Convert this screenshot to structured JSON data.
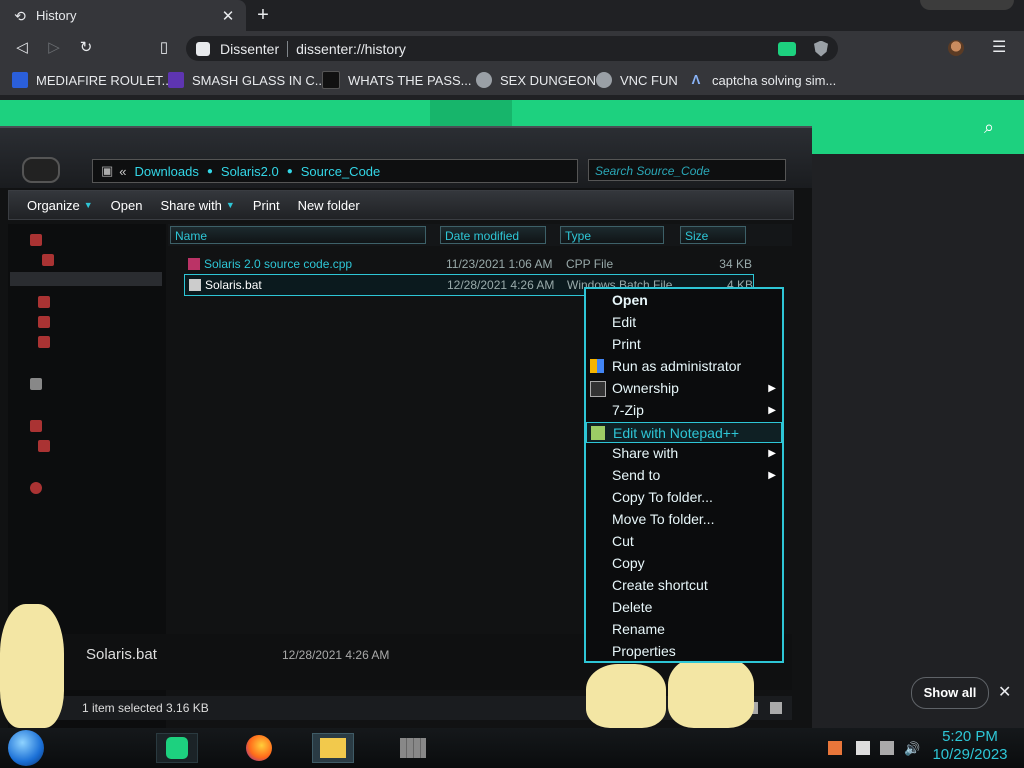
{
  "browser": {
    "tab_title": "History",
    "tab_close": "✕",
    "new_tab": "+",
    "site_name": "Dissenter",
    "url": "dissenter://history",
    "bookmarks": [
      {
        "label": "MEDIAFIRE ROULET...",
        "color": "#2b5fd9"
      },
      {
        "label": "SMASH GLASS IN C...",
        "color": "#5e35b1"
      },
      {
        "label": "WHATS THE PASS...",
        "color": "#222222"
      },
      {
        "label": "SEX DUNGEON",
        "color": "#9aa0a6"
      },
      {
        "label": "VNC FUN",
        "color": "#9aa0a6"
      },
      {
        "label": "captcha solving sim...",
        "color": "#8ab4f8"
      }
    ]
  },
  "explorer": {
    "breadcrumb": [
      "Downloads",
      "Solaris2.0",
      "Source_Code"
    ],
    "breadcrumb_prefix": "«",
    "search_placeholder": "Search Source_Code",
    "commands": [
      "Organize",
      "Open",
      "Share with",
      "Print",
      "New folder"
    ],
    "columns": [
      "Name",
      "Date modified",
      "Type",
      "Size"
    ],
    "files": [
      {
        "name": "Solaris 2.0 source code.cpp",
        "date": "11/23/2021 1:06 AM",
        "type": "CPP File",
        "size": "34 KB"
      },
      {
        "name": "Solaris.bat",
        "date": "12/28/2021 4:26 AM",
        "type": "Windows Batch File",
        "size": "4 KB"
      }
    ],
    "details_name": "Solaris.bat",
    "details_date": "12/28/2021 4:26 AM",
    "status": "1 item selected  3.16 KB"
  },
  "context_menu": [
    {
      "label": "Open",
      "arrow": ""
    },
    {
      "label": "Edit",
      "arrow": ""
    },
    {
      "label": "Print",
      "arrow": ""
    },
    {
      "label": "Run as administrator",
      "arrow": ""
    },
    {
      "label": "Ownership",
      "arrow": "▶"
    },
    {
      "label": "7-Zip",
      "arrow": "▶"
    },
    {
      "label": "Edit with Notepad++",
      "arrow": ""
    },
    {
      "label": "Share with",
      "arrow": "▶"
    },
    {
      "label": "Send to",
      "arrow": "▶"
    },
    {
      "label": "Copy To folder...",
      "arrow": ""
    },
    {
      "label": "Move To folder...",
      "arrow": ""
    },
    {
      "label": "Cut",
      "arrow": ""
    },
    {
      "label": "Copy",
      "arrow": ""
    },
    {
      "label": "Create shortcut",
      "arrow": ""
    },
    {
      "label": "Delete",
      "arrow": ""
    },
    {
      "label": "Rename",
      "arrow": ""
    },
    {
      "label": "Properties",
      "arrow": ""
    }
  ],
  "downloads": {
    "show_all": "Show all",
    "close": "✕"
  },
  "taskbar": {
    "time": "5:20 PM",
    "date": "10/29/2023"
  },
  "colors": {
    "accent_green": "#1dd17f",
    "explorer_cyan": "#2ec6d6"
  }
}
